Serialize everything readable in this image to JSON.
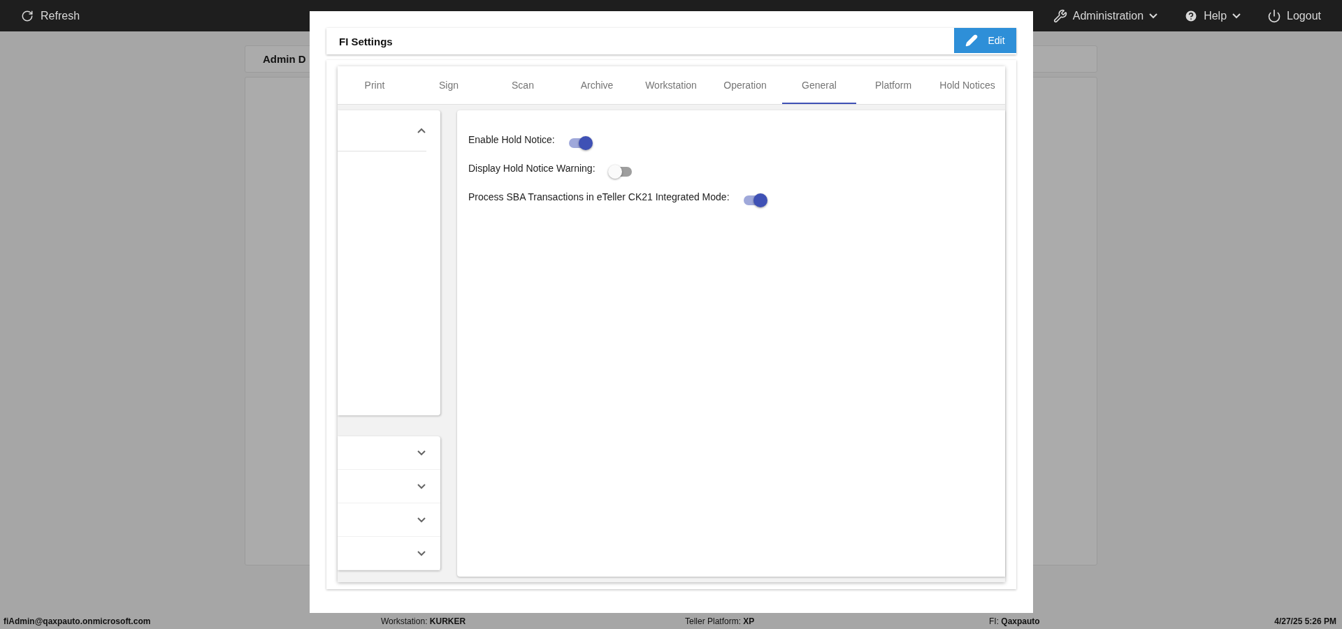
{
  "top_bar": {
    "refresh": "Refresh",
    "menus": [
      {
        "kind": "admin",
        "label": "Administration",
        "dropdown": true
      },
      {
        "kind": "help",
        "label": "Help",
        "dropdown": true
      },
      {
        "kind": "logout",
        "label": "Logout",
        "dropdown": false
      }
    ]
  },
  "page": {
    "card_title": "Admin D"
  },
  "dialog": {
    "title": "FI Settings",
    "edit_button": "Edit",
    "tabs": [
      {
        "label": "Print",
        "selected": false
      },
      {
        "label": "Sign",
        "selected": false
      },
      {
        "label": "Scan",
        "selected": false
      },
      {
        "label": "Archive",
        "selected": false
      },
      {
        "label": "Workstation",
        "selected": false
      },
      {
        "label": "Operation",
        "selected": false
      },
      {
        "label": "General",
        "selected": true
      },
      {
        "label": "Platform",
        "selected": false
      },
      {
        "label": "Hold Notices",
        "selected": false
      }
    ],
    "accordion": [
      {
        "expanded": true
      },
      {
        "expanded": false
      },
      {
        "expanded": false
      },
      {
        "expanded": false
      },
      {
        "expanded": false
      }
    ],
    "toggles": [
      {
        "label": "Enable Hold Notice:",
        "on": true
      },
      {
        "label": "Display Hold Notice Warning:",
        "on": false
      },
      {
        "label": "Process SBA Transactions in eTeller CK21 Integrated Mode:",
        "on": true
      }
    ]
  },
  "status_bar": {
    "user": "fiAdmin@qaxpauto.onmicrosoft.com",
    "workstation": "Workstation: **KURKER**",
    "platform": "Teller Platform: **XP**",
    "fi": "FI: **Qaxpauto**",
    "datetime": "4/27/25 5:26 PM"
  }
}
